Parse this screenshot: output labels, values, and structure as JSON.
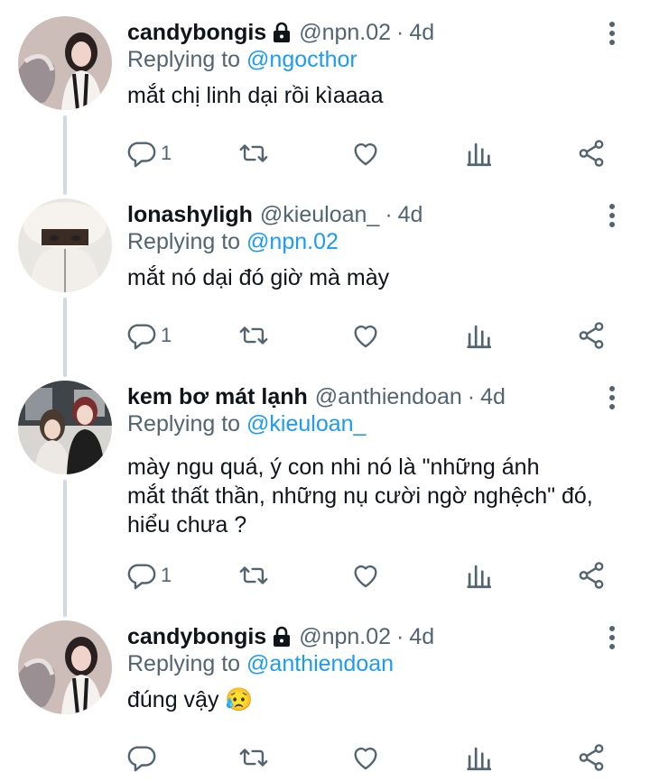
{
  "tweets": [
    {
      "name": "candybongis",
      "locked": true,
      "handle": "@npn.02",
      "dot": "·",
      "time": "4d",
      "reply_prefix": "Replying to",
      "reply_to": "@ngocthor",
      "text": "mắt chị linh dại rồi kìaaaa",
      "reply_count": "1",
      "avatar": "candybongis-avatar"
    },
    {
      "name": "lonashyligh",
      "locked": false,
      "handle": "@kieuloan_",
      "dot": "·",
      "time": "4d",
      "reply_prefix": "Replying to",
      "reply_to": "@npn.02",
      "text": "mắt nó dại đó giờ mà mày",
      "reply_count": "1",
      "avatar": "lonashyligh-avatar"
    },
    {
      "name": "kem bơ mát lạnh",
      "locked": false,
      "handle": "@anthiendoan",
      "dot": "·",
      "time": "4d",
      "reply_prefix": "Replying to",
      "reply_to": "@kieuloan_",
      "text_lines": [
        "mày ngu quá, ý con nhi nó là \"những ánh",
        "mắt thất thần, những nụ cười ngờ nghệch\" đó,",
        "hiểu chưa ?"
      ],
      "reply_count": "1",
      "avatar": "kem-bo-avatar"
    },
    {
      "name": "candybongis",
      "locked": true,
      "handle": "@npn.02",
      "dot": "·",
      "time": "4d",
      "reply_prefix": "Replying to",
      "reply_to": "@anthiendoan",
      "text": "đúng vậy 😥",
      "reply_count": "",
      "avatar": "candybongis-avatar"
    }
  ],
  "colors": {
    "text": "#0f1419",
    "secondary": "#536471",
    "accent": "#1d9bf0",
    "thread": "#cfd9de"
  },
  "icons": [
    "reply-icon",
    "retweet-icon",
    "like-icon",
    "analytics-icon",
    "share-icon",
    "more-icon",
    "lock-icon"
  ]
}
